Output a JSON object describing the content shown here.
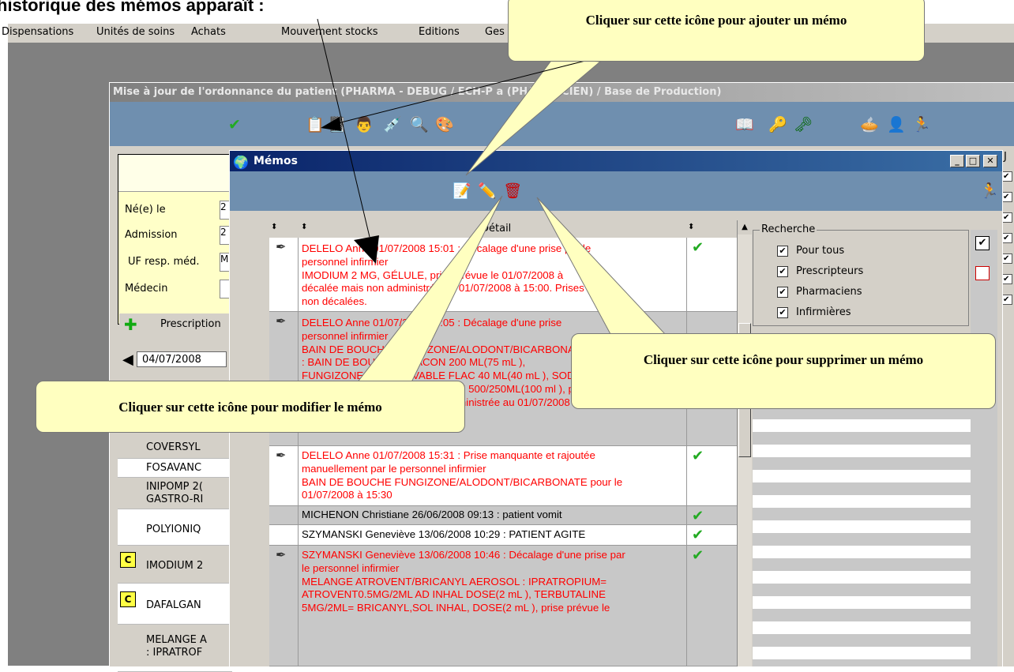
{
  "doc_heading": "historique des mémos apparaît :",
  "menubar": {
    "items": [
      "Dispensations",
      "Unités de soins",
      "Achats",
      "Mouvement stocks",
      "Editions",
      "Ges"
    ]
  },
  "main_window": {
    "title": "Mise à jour de l'ordonnance du patient (PHARMA - DEBUG / ECH-P          a (PHARMACIEN) / Base de Production)"
  },
  "patient": {
    "fields": [
      {
        "label": "Né(e) le",
        "value": "2"
      },
      {
        "label": "Admission",
        "value": "2"
      },
      {
        "label": "UF resp. méd.",
        "value": "M"
      },
      {
        "label": "Médecin",
        "value": ""
      }
    ],
    "prescription_tab": "Prescription",
    "date": "04/07/2008"
  },
  "drugs": [
    {
      "name": "COVERSYL",
      "badge": ""
    },
    {
      "name": "FOSAVANC",
      "badge": ""
    },
    {
      "name": "INIPOMP 2(",
      "line2": "GASTRO-RI",
      "badge": ""
    },
    {
      "name": "POLYIONIQ",
      "badge": ""
    },
    {
      "name": "IMODIUM 2",
      "badge": "C"
    },
    {
      "name": "DAFALGAN",
      "badge": "C"
    },
    {
      "name": "MELANGE A",
      "line2": ": IPRATROF",
      "badge": ""
    }
  ],
  "memo_window": {
    "title": "Mémos",
    "grid_header": {
      "detail": "Détail"
    },
    "rows": [
      {
        "has_pen": true,
        "checked": true,
        "color": "red",
        "text": "DELELO Anne 01/07/2008 15:01 : Décalage d'une prise par le\npersonnel infirmier\nIMODIUM 2 MG, GÉLULE, prise prévue le 01/07/2008 à\ndécalée mais non administrée au 01/07/2008 à 15:00. Prises\nnon décalées."
      },
      {
        "has_pen": true,
        "checked": false,
        "color": "red",
        "text": "DELELO Anne 01/07/2008 15:05 : Décalage d'une prise\npersonnel infirmier\nBAIN DE BOUCHE FUNGIZONE/ALODONT/BICARBONATE\n: BAIN DE BOUCHE, FLACON 200 ML(75 mL ),\nFUNGIZONE SUSP BUVABLE FLAC 40 ML(40 mL ), SODIUM\nBICARBONATE 1,4% BTE VERRE 500/250ML(100 ml ), prise prévue le\n01/07/2008 à 11:30 décalée et administrée au 01/07/2008 à 15:00.\nPrises suivantes non décalées."
      },
      {
        "has_pen": true,
        "checked": true,
        "color": "red",
        "text": "DELELO Anne 01/07/2008 15:31 : Prise manquante et rajoutée\nmanuellement par le personnel infirmier\nBAIN DE BOUCHE FUNGIZONE/ALODONT/BICARBONATE pour le\n01/07/2008 à 15:30"
      },
      {
        "has_pen": false,
        "checked": true,
        "color": "black",
        "text": "MICHENON Christiane 26/06/2008 09:13 : patient vomit"
      },
      {
        "has_pen": false,
        "checked": true,
        "color": "black",
        "text": "SZYMANSKI Geneviève 13/06/2008 10:29 : PATIENT AGITE"
      },
      {
        "has_pen": true,
        "checked": true,
        "color": "red",
        "text": "SZYMANSKI Geneviève 13/06/2008 10:46 : Décalage d'une prise par\nle personnel infirmier\nMELANGE ATROVENT/BRICANYL AEROSOL : IPRATROPIUM=\nATROVENT0.5MG/2ML AD INHAL DOSE(2 mL ), TERBUTALINE\n5MG/2ML= BRICANYL,SOL INHAL, DOSE(2 mL ), prise prévue le"
      }
    ],
    "search": {
      "legend": "Recherche",
      "filters": [
        {
          "label": "Pour tous",
          "checked": true
        },
        {
          "label": "Prescripteurs",
          "checked": true
        },
        {
          "label": "Pharmaciens",
          "checked": true
        },
        {
          "label": "Infirmières",
          "checked": true
        }
      ]
    }
  },
  "callouts": {
    "add": "Cliquer sur cette icône pour ajouter un mémo",
    "delete": "Cliquer sur cette icône pour supprimer un mémo",
    "edit": "Cliquer sur cette icône pour modifier le mémo"
  },
  "colors": {
    "memo_red": "#ff0000",
    "callout_fill": "#ffffc0",
    "toolbar": "#6f8faf",
    "check_green": "#22aa22"
  }
}
